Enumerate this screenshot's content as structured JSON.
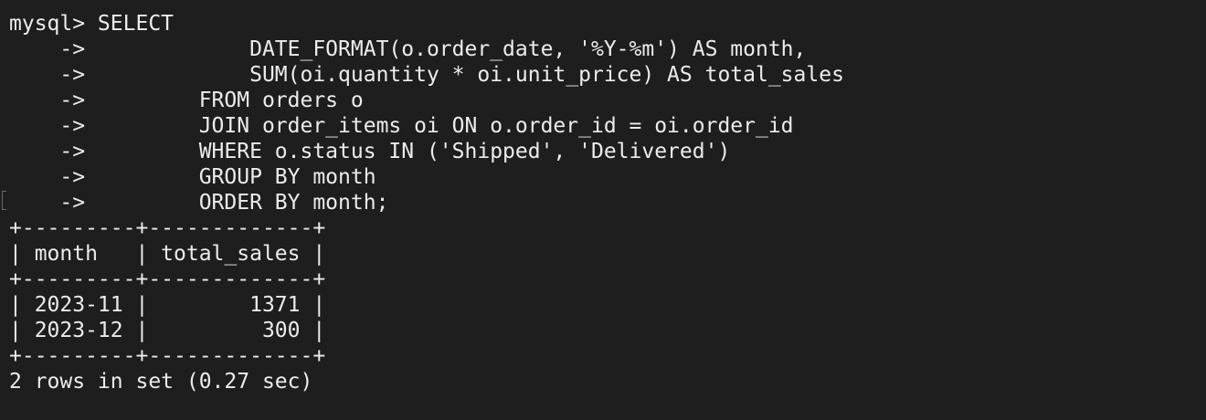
{
  "terminal": {
    "lines": [
      "mysql> SELECT",
      "    ->             DATE_FORMAT(o.order_date, '%Y-%m') AS month,",
      "    ->             SUM(oi.quantity * oi.unit_price) AS total_sales",
      "    ->         FROM orders o",
      "    ->         JOIN order_items oi ON o.order_id = oi.order_id",
      "    ->         WHERE o.status IN ('Shipped', 'Delivered')",
      "    ->         GROUP BY month",
      "    ->         ORDER BY month;",
      "+---------+-------------+",
      "| month   | total_sales |",
      "+---------+-------------+",
      "| 2023-11 |        1371 |",
      "| 2023-12 |         300 |",
      "+---------+-------------+",
      "2 rows in set (0.27 sec)"
    ]
  }
}
